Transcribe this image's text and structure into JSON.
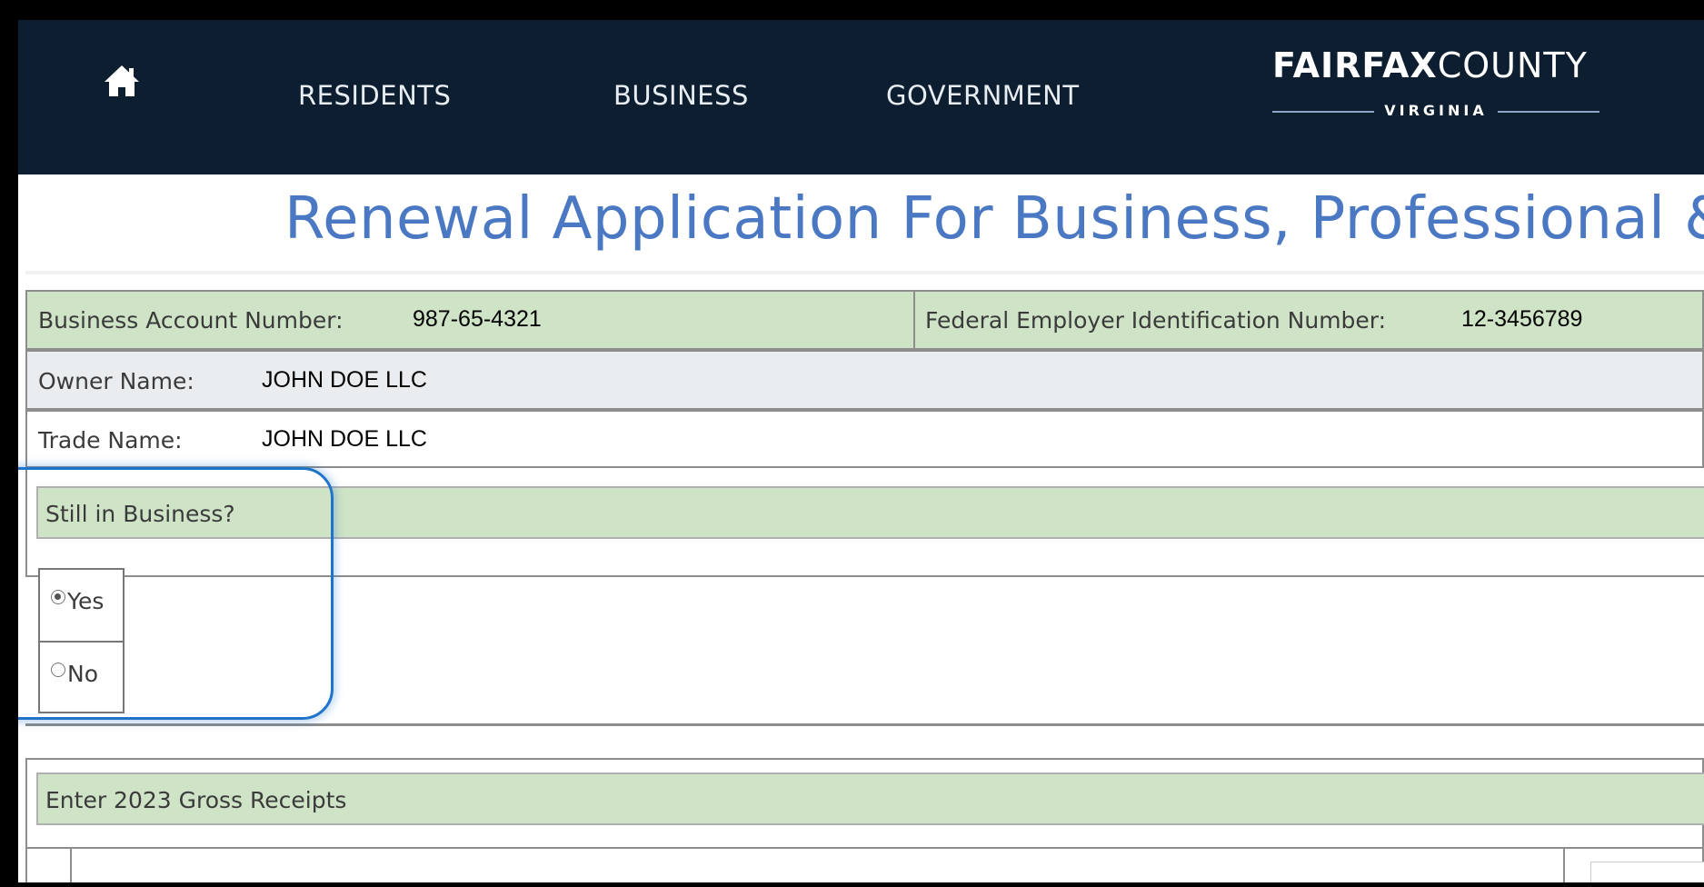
{
  "header": {
    "nav": [
      "RESIDENTS",
      "BUSINESS",
      "GOVERNMENT"
    ],
    "logo": {
      "bold": "FAIRFAX",
      "regular": "COUNTY",
      "sub": "VIRGINIA"
    },
    "icons": {
      "home": "home-icon"
    }
  },
  "page": {
    "title": "Renewal Application For Business, Professional & Oc"
  },
  "account": {
    "business_account_label": "Business Account Number:",
    "business_account_value": "987-65-4321",
    "fein_label": "Federal Employer Identification Number:",
    "fein_value": "12-3456789"
  },
  "owner": {
    "label": "Owner Name:",
    "value": "JOHN DOE LLC"
  },
  "trade": {
    "label": "Trade Name:",
    "value": "JOHN DOE LLC"
  },
  "still_in_business": {
    "question": "Still in Business?",
    "options": [
      {
        "label": "Yes",
        "selected": true
      },
      {
        "label": "No",
        "selected": false
      }
    ]
  },
  "gross_receipts": {
    "header": "Enter 2023 Gross Receipts"
  },
  "colors": {
    "nav_bg": "#0c1e2f",
    "title_blue": "#4a78c2",
    "section_green": "#cfe3c6",
    "highlight_blue": "#1f74c9"
  }
}
